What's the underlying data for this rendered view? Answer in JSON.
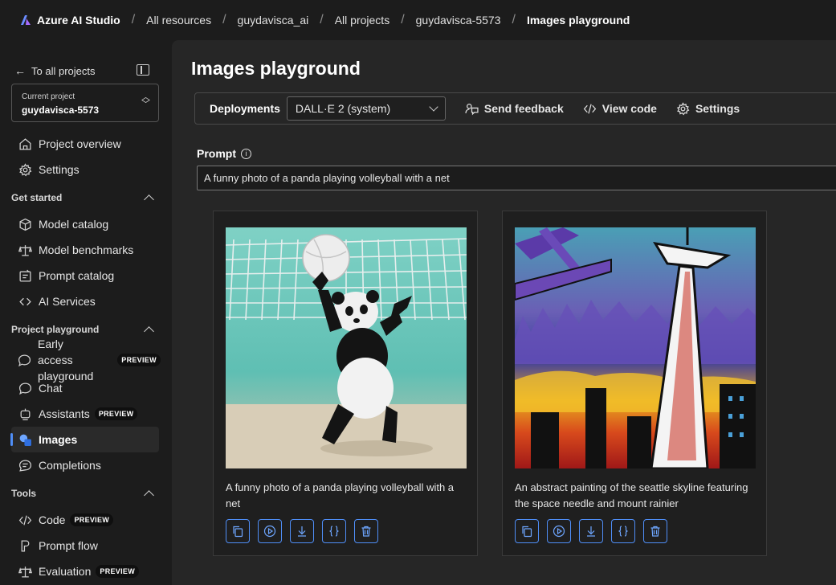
{
  "topbar": {
    "brand": "Azure AI Studio",
    "breadcrumbs": [
      "All resources",
      "guydavisca_ai",
      "All projects",
      "guydavisca-5573",
      "Images playground"
    ]
  },
  "sidebar": {
    "back_label": "To all projects",
    "project_card": {
      "label": "Current project",
      "value": "guydavisca-5573"
    },
    "top_items": [
      {
        "label": "Project overview",
        "icon": "home-icon"
      },
      {
        "label": "Settings",
        "icon": "gear-icon"
      }
    ],
    "sections": [
      {
        "title": "Get started",
        "items": [
          {
            "label": "Model catalog",
            "icon": "cube-icon"
          },
          {
            "label": "Model benchmarks",
            "icon": "scale-icon"
          },
          {
            "label": "Prompt catalog",
            "icon": "catalog-icon"
          },
          {
            "label": "AI Services",
            "icon": "link-icon"
          }
        ]
      },
      {
        "title": "Project playground",
        "items": [
          {
            "label_line1": "Early access",
            "label_line2": "playground",
            "icon": "chat-bubble-icon",
            "badge": "PREVIEW"
          },
          {
            "label": "Chat",
            "icon": "chat-icon"
          },
          {
            "label": "Assistants",
            "icon": "assistant-icon",
            "badge": "PREVIEW"
          },
          {
            "label": "Images",
            "icon": "images-icon",
            "active": true
          },
          {
            "label": "Completions",
            "icon": "completions-icon"
          }
        ]
      },
      {
        "title": "Tools",
        "items": [
          {
            "label": "Code",
            "icon": "code-icon",
            "badge": "PREVIEW"
          },
          {
            "label": "Prompt flow",
            "icon": "flow-icon"
          },
          {
            "label": "Evaluation",
            "icon": "evaluation-icon",
            "badge": "PREVIEW"
          }
        ]
      }
    ]
  },
  "main": {
    "title": "Images playground",
    "toolbar": {
      "deployments_label": "Deployments",
      "deployment_value": "DALL·E 2 (system)",
      "send_feedback": "Send feedback",
      "view_code": "View code",
      "settings": "Settings"
    },
    "prompt": {
      "label": "Prompt",
      "value": "A funny photo of a panda playing volleyball with a net"
    },
    "images": [
      {
        "caption": "A funny photo of a panda playing volleyball with a net",
        "subject": "panda-volleyball"
      },
      {
        "caption": "An abstract painting of the seattle skyline featuring the space needle and mount rainier",
        "subject": "seattle-skyline-painting"
      }
    ],
    "colors": {
      "accent": "#4f8ef7",
      "background": "#262626",
      "sidebar": "#1c1c1c"
    }
  }
}
